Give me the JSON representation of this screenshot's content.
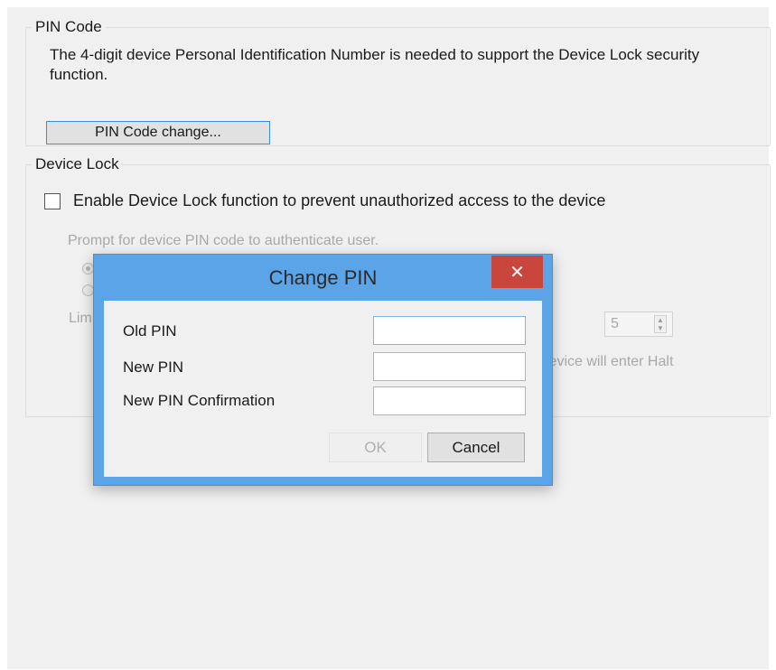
{
  "pin_group": {
    "title": "PIN Code",
    "description": "The 4-digit device Personal Identification Number is needed to support the Device Lock security function.",
    "change_button": "PIN Code change..."
  },
  "lock_group": {
    "title": "Device Lock",
    "enable_label": "Enable Device Lock function to prevent unauthorized access to the device",
    "enable_checked": false,
    "prompt_label": "Prompt for device PIN code to authenticate user.",
    "limit_label_partial": "Lim",
    "spinner_value": "5",
    "halt_text_partial": "levice will enter Halt"
  },
  "dialog": {
    "title": "Change PIN",
    "close_glyph": "✕",
    "fields": {
      "old_pin_label": "Old PIN",
      "new_pin_label": "New PIN",
      "confirm_label": "New PIN Confirmation"
    },
    "ok_label": "OK",
    "cancel_label": "Cancel"
  },
  "colors": {
    "dialog_frame": "#5ba4e8",
    "close_button": "#c9463d",
    "focus_border": "#3c8ddb"
  }
}
